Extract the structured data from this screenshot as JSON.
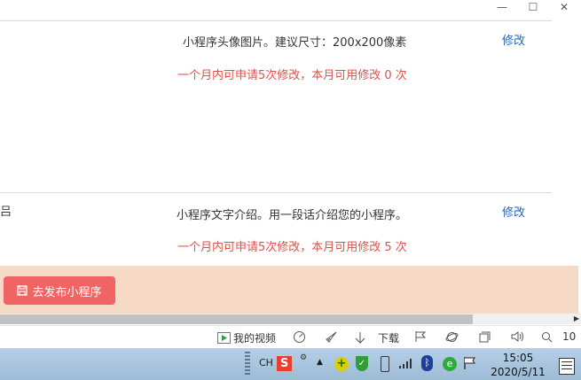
{
  "window": {
    "minimize": "—",
    "maximize": "☐",
    "close": "✕"
  },
  "rows": [
    {
      "cut_text": "",
      "description": "小程序头像图片。建议尺寸：200x200像素",
      "limit_text": "一个月内可申请5次修改，本月可用修改 0 次",
      "modify_label": "修改"
    },
    {
      "cut_text": "吕",
      "description": "小程序文字介绍。用一段话介绍您的小程序。",
      "limit_text": "一个月内可申请5次修改，本月可用修改 5 次",
      "modify_label": "修改"
    }
  ],
  "footer": {
    "publish_label": "去发布小程序"
  },
  "status_bar": {
    "my_video": "我的视频",
    "download": "下载",
    "zoom": "10"
  },
  "taskbar": {
    "ime": "CH",
    "time": "15:05",
    "date": "2020/5/11"
  }
}
